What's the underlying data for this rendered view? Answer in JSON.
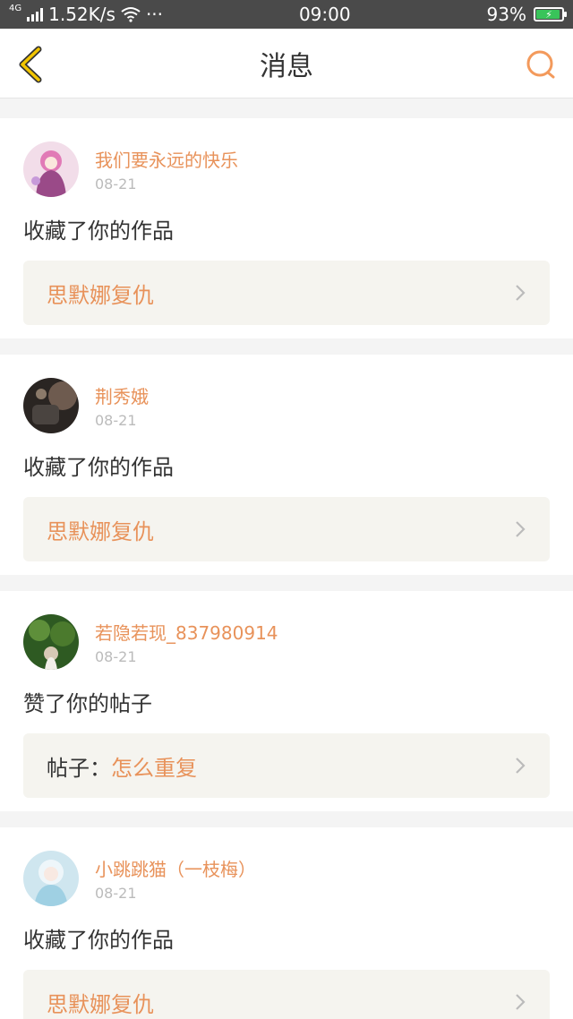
{
  "status_bar": {
    "network": "4G",
    "speed": "1.52K/s",
    "dots": "···",
    "time": "09:00",
    "battery": "93%"
  },
  "header": {
    "title": "消息",
    "back_icon": "back-chevron-icon",
    "search_icon": "search-icon"
  },
  "colors": {
    "accent": "#e8925a",
    "back_icon": "#f2c500",
    "target_bg": "#f5f4ef"
  },
  "messages": [
    {
      "username": "我们要永远的快乐",
      "date": "08-21",
      "action": "收藏了你的作品",
      "target_prefix": "",
      "target": "思默娜复仇"
    },
    {
      "username": "荆秀娥",
      "date": "08-21",
      "action": "收藏了你的作品",
      "target_prefix": "",
      "target": "思默娜复仇"
    },
    {
      "username": "若隐若现_837980914",
      "date": "08-21",
      "action": "赞了你的帖子",
      "target_prefix": "帖子：",
      "target": "怎么重复"
    },
    {
      "username": "小跳跳猫（一枝梅）",
      "date": "08-21",
      "action": "收藏了你的作品",
      "target_prefix": "",
      "target": "思默娜复仇"
    }
  ]
}
